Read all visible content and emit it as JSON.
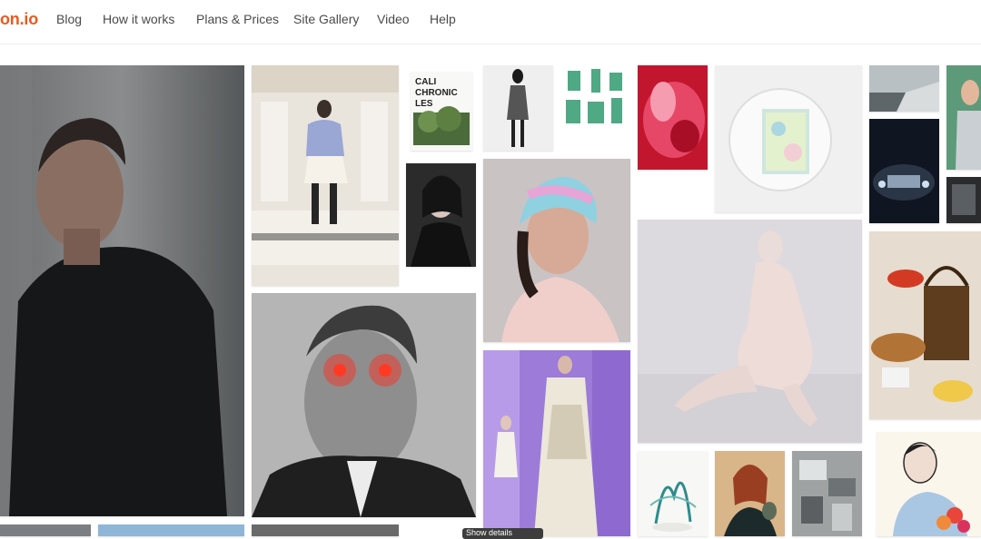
{
  "brand": {
    "logo_text": "on.io",
    "accent": "#e85a1e"
  },
  "nav": {
    "items": [
      {
        "label": "Blog"
      },
      {
        "label": "How it works"
      },
      {
        "label": "Plans & Prices"
      },
      {
        "label": "Site Gallery"
      },
      {
        "label": "Video"
      },
      {
        "label": "Help"
      }
    ]
  },
  "gallery": {
    "book_cover": {
      "line1": "CALI",
      "line2": "CHRONIC",
      "line3": "LES"
    },
    "tooltip": "Show details"
  }
}
